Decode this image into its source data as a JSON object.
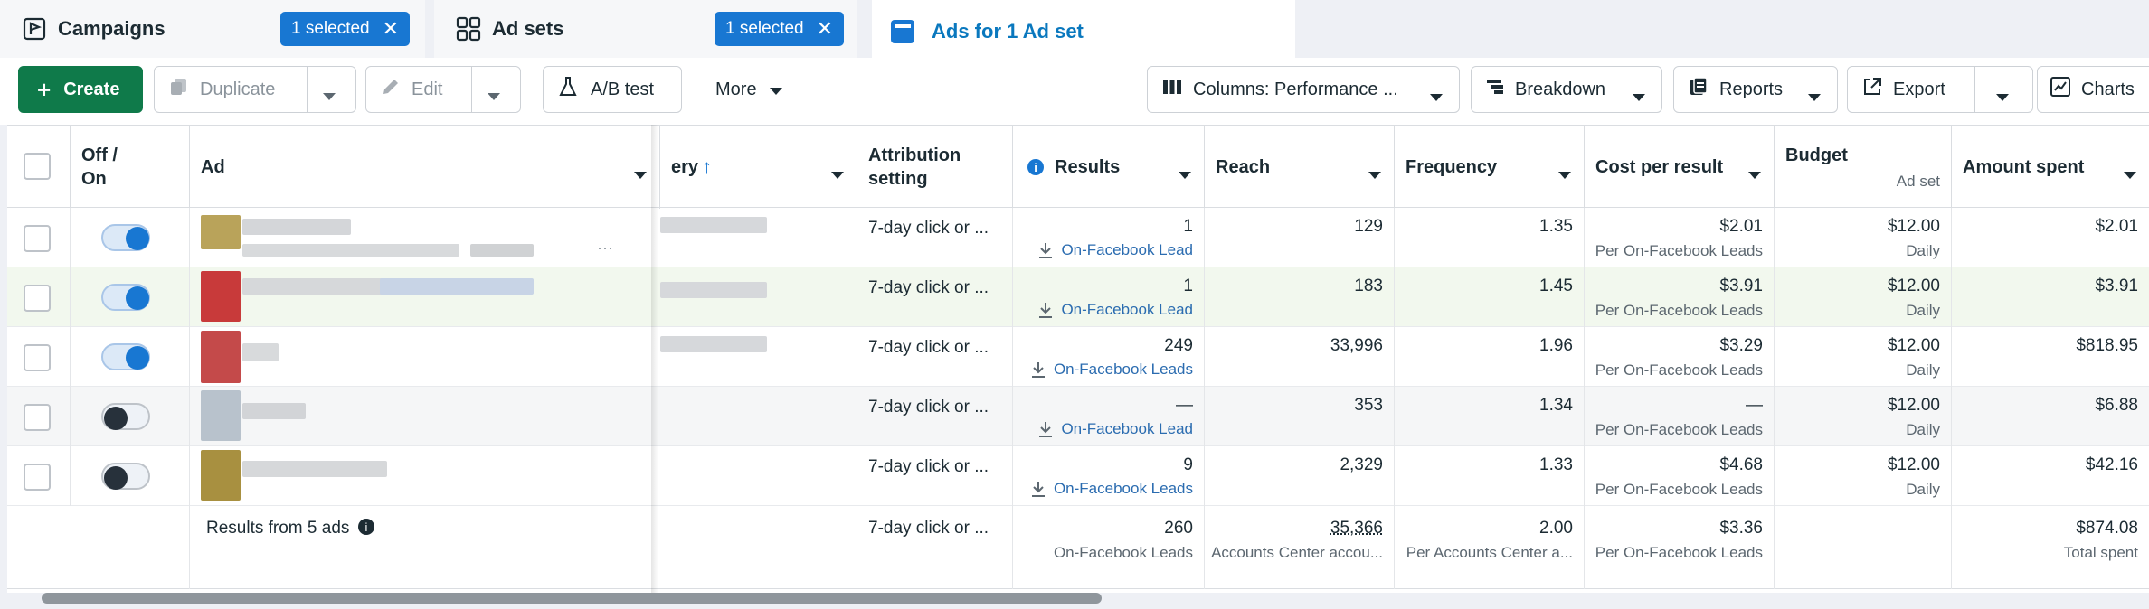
{
  "tabs": [
    {
      "label": "Campaigns",
      "selected": "1 selected",
      "icon": "campaign-flag-icon"
    },
    {
      "label": "Ad sets",
      "selected": "1 selected",
      "icon": "grid-icon"
    },
    {
      "label": "Ads for 1 Ad set",
      "icon": "ad-icon"
    }
  ],
  "toolbar": {
    "create": "Create",
    "duplicate": "Duplicate",
    "edit": "Edit",
    "ab_test": "A/B test",
    "more": "More",
    "columns": "Columns: Performance ...",
    "breakdown": "Breakdown",
    "reports": "Reports",
    "export": "Export",
    "charts": "Charts"
  },
  "columns": {
    "off_on": "Off / On",
    "ad": "Ad",
    "delivery": "ery",
    "attribution": "Attribution setting",
    "results": "Results",
    "reach": "Reach",
    "frequency": "Frequency",
    "cost_per_result": "Cost per result",
    "budget": "Budget",
    "budget_sub": "Ad set",
    "amount_spent": "Amount spent"
  },
  "rows": [
    {
      "on": true,
      "attribution": "7-day click or ...",
      "results": "1",
      "results_type": "On-Facebook Lead",
      "reach": "129",
      "frequency": "1.35",
      "cost": "$2.01",
      "cost_sub": "Per On-Facebook Leads",
      "budget": "$12.00",
      "budget_sub": "Daily",
      "spent": "$2.01"
    },
    {
      "on": true,
      "attribution": "7-day click or ...",
      "results": "1",
      "results_type": "On-Facebook Lead",
      "reach": "183",
      "frequency": "1.45",
      "cost": "$3.91",
      "cost_sub": "Per On-Facebook Leads",
      "budget": "$12.00",
      "budget_sub": "Daily",
      "spent": "$3.91"
    },
    {
      "on": true,
      "attribution": "7-day click or ...",
      "results": "249",
      "results_type": "On-Facebook Leads",
      "reach": "33,996",
      "frequency": "1.96",
      "cost": "$3.29",
      "cost_sub": "Per On-Facebook Leads",
      "budget": "$12.00",
      "budget_sub": "Daily",
      "spent": "$818.95"
    },
    {
      "on": false,
      "attribution": "7-day click or ...",
      "results": "—",
      "results_type": "On-Facebook Lead",
      "reach": "353",
      "frequency": "1.34",
      "cost": "—",
      "cost_sub": "Per On-Facebook Leads",
      "budget": "$12.00",
      "budget_sub": "Daily",
      "spent": "$6.88"
    },
    {
      "on": false,
      "attribution": "7-day click or ...",
      "results": "9",
      "results_type": "On-Facebook Leads",
      "reach": "2,329",
      "frequency": "1.33",
      "cost": "$4.68",
      "cost_sub": "Per On-Facebook Leads",
      "budget": "$12.00",
      "budget_sub": "Daily",
      "spent": "$42.16"
    }
  ],
  "summary": {
    "label": "Results from 5 ads",
    "attribution": "7-day click or ...",
    "results": "260",
    "results_sub": "On-Facebook Leads",
    "reach": "35,366",
    "reach_sub": "Accounts Center accou...",
    "frequency": "2.00",
    "frequency_sub": "Per Accounts Center a...",
    "cost": "$3.36",
    "cost_sub": "Per On-Facebook Leads",
    "spent": "$874.08",
    "spent_sub": "Total spent"
  },
  "colors": {
    "accent": "#1877d2",
    "create": "#0f7a4a",
    "link": "#2b6cb0"
  }
}
